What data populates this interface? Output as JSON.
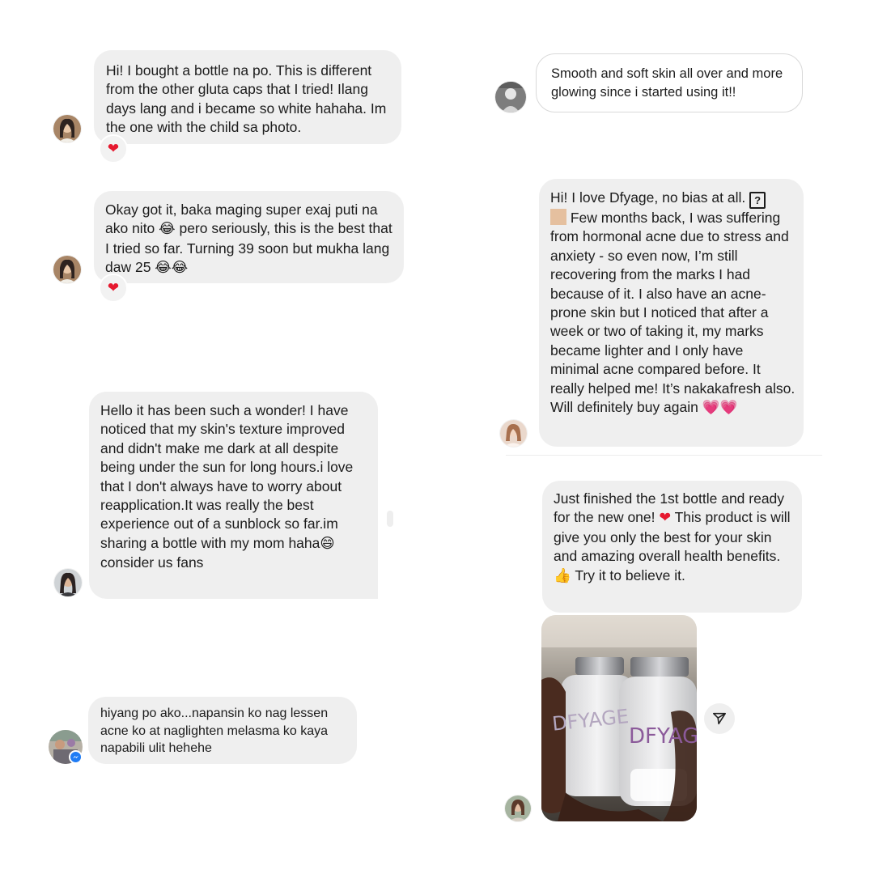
{
  "messages": [
    {
      "text": "Hi! I bought a bottle na po. This is different from the other gluta caps that I tried! Ilang days lang and i became so white hahaha. Im the one with the child sa photo."
    },
    {
      "text_a": "Okay got it, baka maging super exaj puti na ako nito ",
      "emoji_a": "😂",
      "text_b": " pero seriously, this is the best that I tried so far. Turning 39 soon but mukha lang daw 25 ",
      "emoji_b": "😂😂"
    },
    {
      "text_a": "Hello it has been such a wonder! I have noticed that my skin's texture improved and didn't make me dark at all despite being under the sun for long hours.i love that I don't always have to worry about reapplication.It was really the best experience out of a sunblock so far.im sharing a bottle with my mom haha",
      "emoji_a": "😄",
      "text_b": " consider us fans"
    },
    {
      "text": "hiyang po ako...napansin ko nag lessen acne ko at naglighten melasma ko kaya napabili ulit hehehe"
    },
    {
      "text": "Smooth and soft skin all over and more glowing since i started using it!!"
    },
    {
      "text_a": "Hi! I love Dfyage, no bias at all. ",
      "emoji_a": "?",
      "text_b": " Few months back, I was suffering from hormonal acne due to stress and anxiety - so even now, I’m still recovering from the marks I had because of it. I also have an acne-prone skin but I noticed that after a week or two of taking it, my marks became lighter and I only have minimal acne compared before. It really helped me! It’s nakakafresh also. Will definitely buy again ",
      "emoji_b": "💗💗"
    },
    {
      "text_a": "Just finished the 1st bottle and ready for the new one! ",
      "emoji_a": "❤",
      "text_b": " This product is will give you only the best for your skin and amazing overall health benefits. ",
      "emoji_b": "👍",
      "text_c": " Try it to believe it."
    }
  ],
  "reactions": {
    "heart": "❤"
  },
  "product_photo": {
    "brand_label": "DFYAGE",
    "icon": "product-bottles-photo"
  },
  "icons": {
    "send": "send-icon",
    "messenger_badge": "messenger-badge-icon"
  },
  "colors": {
    "bubble": "#efefef",
    "heart": "#e6192f",
    "messenger": "#1f7cf5"
  }
}
